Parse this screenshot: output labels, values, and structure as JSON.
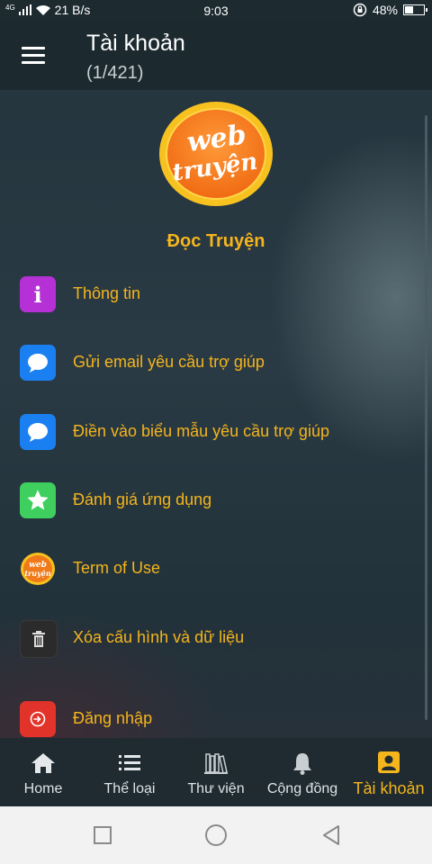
{
  "status_bar": {
    "network": "4G",
    "speed": "21 B/s",
    "time": "9:03",
    "battery_percent": "48%",
    "battery_level": 0.48
  },
  "header": {
    "title": "Tài khoản",
    "subtitle": "(1/421)",
    "menu_icon": "hamburger-menu-icon"
  },
  "app": {
    "name": "Đọc Truyện",
    "logo_text_line1": "web",
    "logo_text_line2": "truyện"
  },
  "menu": [
    {
      "label": "Thông tin",
      "icon": "info-icon",
      "color": "#b531d6"
    },
    {
      "label": "Gửi email yêu cầu trợ giúp",
      "icon": "chat-bubble-icon",
      "color": "#1a80f2"
    },
    {
      "label": "Điền vào biểu mẫu yêu cầu trợ giúp",
      "icon": "chat-bubble-icon",
      "color": "#1a80f2"
    },
    {
      "label": "Đánh giá ứng dụng",
      "icon": "star-icon",
      "color": "#3ecf5e"
    },
    {
      "label": "Term of Use",
      "icon": "webtruyen-logo-icon",
      "color": "#f08a1c"
    },
    {
      "label": "Xóa cấu hình và dữ liệu",
      "icon": "trash-icon",
      "color": "#2b2b2b"
    },
    {
      "label": "Đăng nhập",
      "icon": "login-icon",
      "color": "#e2332a"
    }
  ],
  "bottom_nav": [
    {
      "label": "Home",
      "icon": "home-icon",
      "active": false
    },
    {
      "label": "Thể loại",
      "icon": "list-icon",
      "active": false
    },
    {
      "label": "Thư viện",
      "icon": "library-icon",
      "active": false
    },
    {
      "label": "Cộng đồng",
      "icon": "bell-icon",
      "active": false
    },
    {
      "label": "Tài khoản",
      "icon": "account-icon",
      "active": true
    }
  ],
  "colors": {
    "accent": "#f5b51c",
    "header_bg": "#1c2a30",
    "nav_bg": "#1f2b31"
  }
}
